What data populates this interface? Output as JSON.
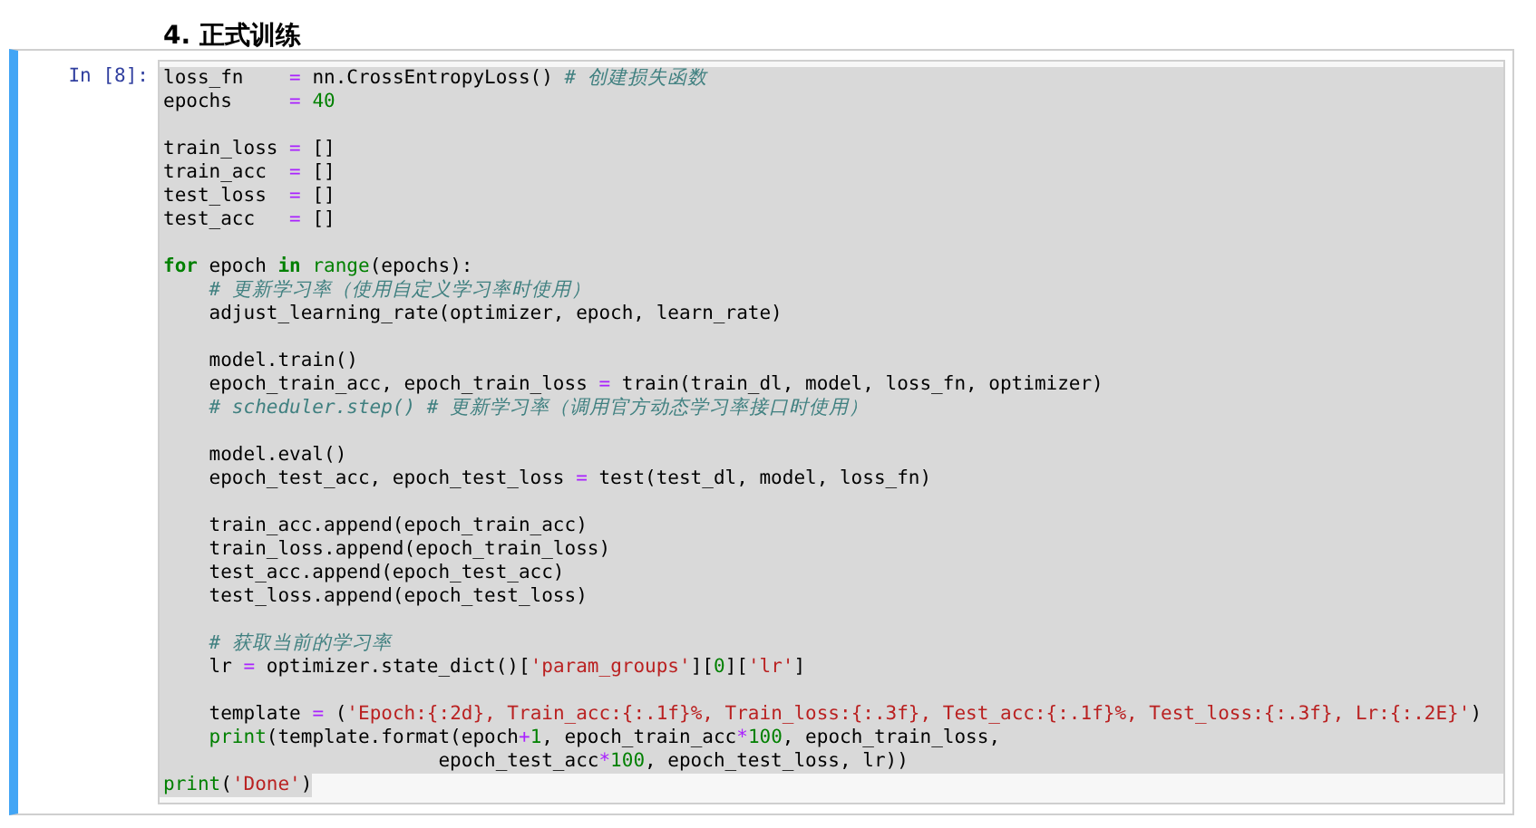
{
  "heading": "4. 正式训练",
  "cell": {
    "prompt": "In [8]:",
    "selected": true,
    "lines": [
      {
        "kind": "code",
        "selected": true,
        "tokens": [
          {
            "kind": "plain",
            "text": "loss_fn    "
          },
          {
            "kind": "operator",
            "text": "="
          },
          {
            "kind": "plain",
            "text": " nn.CrossEntropyLoss() "
          },
          {
            "kind": "comment",
            "text": "# 创建损失函数"
          }
        ]
      },
      {
        "kind": "code",
        "selected": true,
        "tokens": [
          {
            "kind": "plain",
            "text": "epochs     "
          },
          {
            "kind": "operator",
            "text": "="
          },
          {
            "kind": "number",
            "text": " 40"
          }
        ]
      },
      {
        "kind": "blank",
        "selected": true
      },
      {
        "kind": "code",
        "selected": true,
        "tokens": [
          {
            "kind": "plain",
            "text": "train_loss "
          },
          {
            "kind": "operator",
            "text": "="
          },
          {
            "kind": "plain",
            "text": " []"
          }
        ]
      },
      {
        "kind": "code",
        "selected": true,
        "tokens": [
          {
            "kind": "plain",
            "text": "train_acc  "
          },
          {
            "kind": "operator",
            "text": "="
          },
          {
            "kind": "plain",
            "text": " []"
          }
        ]
      },
      {
        "kind": "code",
        "selected": true,
        "tokens": [
          {
            "kind": "plain",
            "text": "test_loss  "
          },
          {
            "kind": "operator",
            "text": "="
          },
          {
            "kind": "plain",
            "text": " []"
          }
        ]
      },
      {
        "kind": "code",
        "selected": true,
        "tokens": [
          {
            "kind": "plain",
            "text": "test_acc   "
          },
          {
            "kind": "operator",
            "text": "="
          },
          {
            "kind": "plain",
            "text": " []"
          }
        ]
      },
      {
        "kind": "blank",
        "selected": true
      },
      {
        "kind": "code",
        "selected": true,
        "tokens": [
          {
            "kind": "keyword",
            "text": "for"
          },
          {
            "kind": "plain",
            "text": " epoch "
          },
          {
            "kind": "keyword",
            "text": "in"
          },
          {
            "kind": "builtin",
            "text": " range"
          },
          {
            "kind": "plain",
            "text": "(epochs):"
          }
        ]
      },
      {
        "kind": "code",
        "selected": true,
        "tokens": [
          {
            "kind": "comment",
            "text": "    # 更新学习率（使用自定义学习率时使用）"
          }
        ]
      },
      {
        "kind": "code",
        "selected": true,
        "tokens": [
          {
            "kind": "plain",
            "text": "    adjust_learning_rate(optimizer, epoch, learn_rate)"
          }
        ]
      },
      {
        "kind": "blank",
        "selected": true
      },
      {
        "kind": "code",
        "selected": true,
        "tokens": [
          {
            "kind": "plain",
            "text": "    model.train()"
          }
        ]
      },
      {
        "kind": "code",
        "selected": true,
        "tokens": [
          {
            "kind": "plain",
            "text": "    epoch_train_acc, epoch_train_loss "
          },
          {
            "kind": "operator",
            "text": "="
          },
          {
            "kind": "plain",
            "text": " train(train_dl, model, loss_fn, optimizer)"
          }
        ]
      },
      {
        "kind": "code",
        "selected": true,
        "tokens": [
          {
            "kind": "comment",
            "text": "    # scheduler.step() # 更新学习率（调用官方动态学习率接口时使用）"
          }
        ]
      },
      {
        "kind": "blank",
        "selected": true
      },
      {
        "kind": "code",
        "selected": true,
        "tokens": [
          {
            "kind": "plain",
            "text": "    model.eval()"
          }
        ]
      },
      {
        "kind": "code",
        "selected": true,
        "tokens": [
          {
            "kind": "plain",
            "text": "    epoch_test_acc, epoch_test_loss "
          },
          {
            "kind": "operator",
            "text": "="
          },
          {
            "kind": "plain",
            "text": " test(test_dl, model, loss_fn)"
          }
        ]
      },
      {
        "kind": "blank",
        "selected": true
      },
      {
        "kind": "code",
        "selected": true,
        "tokens": [
          {
            "kind": "plain",
            "text": "    train_acc.append(epoch_train_acc)"
          }
        ]
      },
      {
        "kind": "code",
        "selected": true,
        "tokens": [
          {
            "kind": "plain",
            "text": "    train_loss.append(epoch_train_loss)"
          }
        ]
      },
      {
        "kind": "code",
        "selected": true,
        "tokens": [
          {
            "kind": "plain",
            "text": "    test_acc.append(epoch_test_acc)"
          }
        ]
      },
      {
        "kind": "code",
        "selected": true,
        "tokens": [
          {
            "kind": "plain",
            "text": "    test_loss.append(epoch_test_loss)"
          }
        ]
      },
      {
        "kind": "blank",
        "selected": true
      },
      {
        "kind": "code",
        "selected": true,
        "tokens": [
          {
            "kind": "comment",
            "text": "    # 获取当前的学习率"
          }
        ]
      },
      {
        "kind": "code",
        "selected": true,
        "tokens": [
          {
            "kind": "plain",
            "text": "    lr "
          },
          {
            "kind": "operator",
            "text": "="
          },
          {
            "kind": "plain",
            "text": " optimizer.state_dict()["
          },
          {
            "kind": "string",
            "text": "'param_groups'"
          },
          {
            "kind": "plain",
            "text": "]["
          },
          {
            "kind": "number",
            "text": "0"
          },
          {
            "kind": "plain",
            "text": "]["
          },
          {
            "kind": "string",
            "text": "'lr'"
          },
          {
            "kind": "plain",
            "text": "]"
          }
        ]
      },
      {
        "kind": "blank",
        "selected": true
      },
      {
        "kind": "code",
        "selected": true,
        "tokens": [
          {
            "kind": "plain",
            "text": "    template "
          },
          {
            "kind": "operator",
            "text": "="
          },
          {
            "kind": "plain",
            "text": " ("
          },
          {
            "kind": "string",
            "text": "'Epoch:{:2d}, Train_acc:{:.1f}%, Train_loss:{:.3f}, Test_acc:{:.1f}%, Test_loss:{:.3f}, Lr:{:.2E}'"
          },
          {
            "kind": "plain",
            "text": ")"
          }
        ]
      },
      {
        "kind": "code",
        "selected": true,
        "tokens": [
          {
            "kind": "builtin",
            "text": "    print"
          },
          {
            "kind": "plain",
            "text": "(template.format(epoch"
          },
          {
            "kind": "operator",
            "text": "+"
          },
          {
            "kind": "number",
            "text": "1"
          },
          {
            "kind": "plain",
            "text": ", epoch_train_acc"
          },
          {
            "kind": "operator",
            "text": "*"
          },
          {
            "kind": "number",
            "text": "100"
          },
          {
            "kind": "plain",
            "text": ", epoch_train_loss,"
          }
        ]
      },
      {
        "kind": "code",
        "selected": true,
        "tokens": [
          {
            "kind": "plain",
            "text": "                        epoch_test_acc"
          },
          {
            "kind": "operator",
            "text": "*"
          },
          {
            "kind": "number",
            "text": "100"
          },
          {
            "kind": "plain",
            "text": ", epoch_test_loss, lr))"
          }
        ]
      },
      {
        "kind": "code",
        "selected": true,
        "tokens": [
          {
            "kind": "builtin",
            "text": "print"
          },
          {
            "kind": "plain",
            "text": "("
          },
          {
            "kind": "string",
            "text": "'Done'"
          },
          {
            "kind": "plain",
            "text": ")"
          }
        ]
      }
    ]
  }
}
